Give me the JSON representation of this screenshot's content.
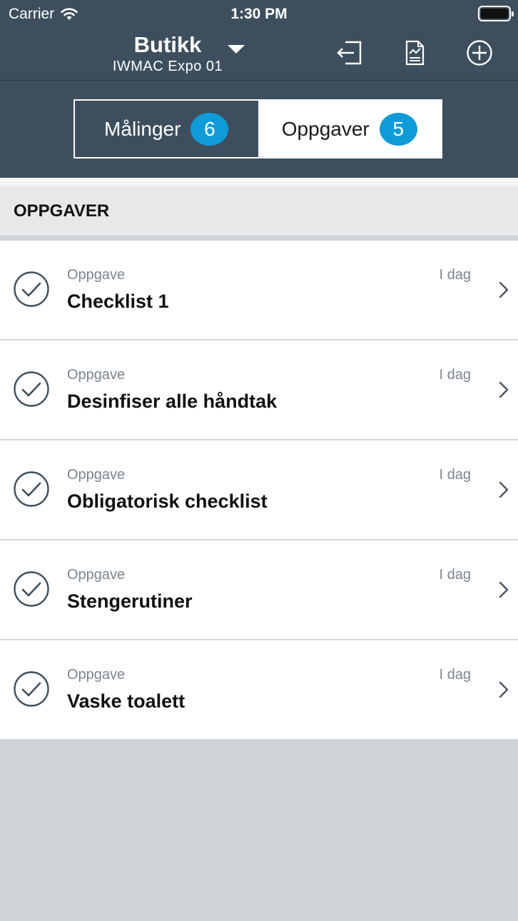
{
  "status_bar": {
    "carrier": "Carrier",
    "time": "1:30 PM"
  },
  "nav": {
    "title": "Butikk",
    "subtitle": "IWMAC Expo 01",
    "icons": [
      "dropdown-arrow-icon",
      "logout-icon",
      "report-icon",
      "add-circle-icon"
    ]
  },
  "segments": [
    {
      "label": "Målinger",
      "count": "6",
      "selected": false
    },
    {
      "label": "Oppgaver",
      "count": "5",
      "selected": true
    }
  ],
  "section": {
    "title": "OPPGAVER"
  },
  "tasks": [
    {
      "type": "Oppgave",
      "name": "Checklist 1",
      "due": "I dag"
    },
    {
      "type": "Oppgave",
      "name": "Desinfiser alle håndtak",
      "due": "I dag"
    },
    {
      "type": "Oppgave",
      "name": "Obligatorisk checklist",
      "due": "I dag"
    },
    {
      "type": "Oppgave",
      "name": "Stengerutiner",
      "due": "I dag"
    },
    {
      "type": "Oppgave",
      "name": "Vaske toalett",
      "due": "I dag"
    }
  ],
  "colors": {
    "header": "#3d4f5e",
    "badge": "#0f9bd7",
    "background": "#cfd3d7"
  }
}
